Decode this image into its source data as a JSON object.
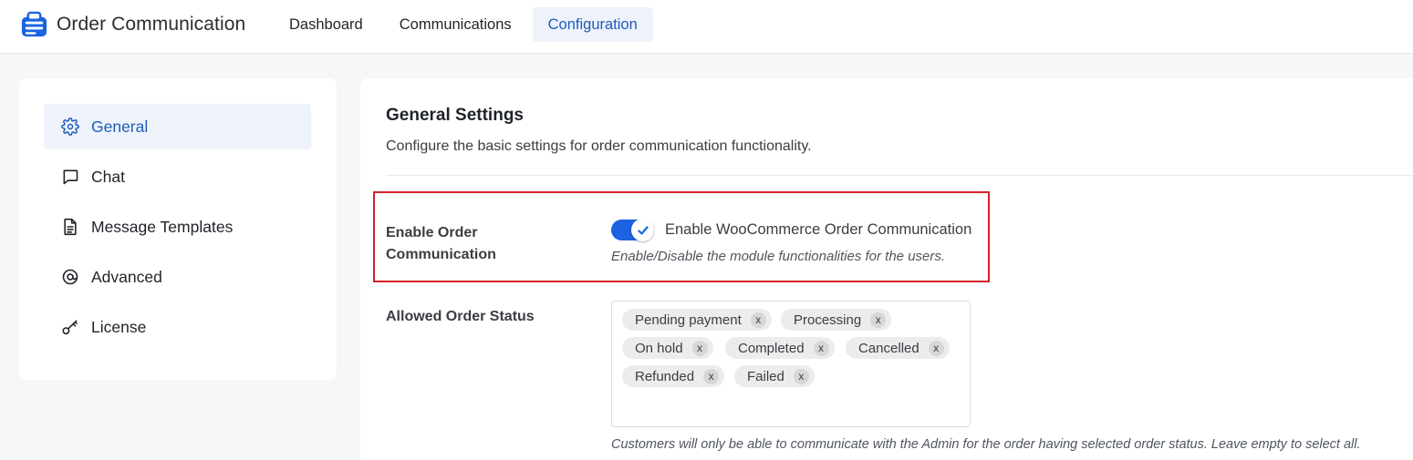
{
  "app": {
    "title": "Order Communication"
  },
  "nav": {
    "tabs": [
      {
        "label": "Dashboard"
      },
      {
        "label": "Communications"
      },
      {
        "label": "Configuration",
        "active": true
      }
    ]
  },
  "sidebar": {
    "items": [
      {
        "label": "General",
        "icon": "gear-icon",
        "active": true
      },
      {
        "label": "Chat",
        "icon": "chat-bubble-icon"
      },
      {
        "label": "Message Templates",
        "icon": "document-icon"
      },
      {
        "label": "Advanced",
        "icon": "at-sign-icon"
      },
      {
        "label": "License",
        "icon": "key-icon"
      }
    ]
  },
  "main": {
    "title": "General Settings",
    "description": "Configure the basic settings for order communication functionality.",
    "enable": {
      "label": "Enable Order Communication",
      "toggle_on": true,
      "toggle_label": "Enable WooCommerce Order Communication",
      "help": "Enable/Disable the module functionalities for the users."
    },
    "statuses": {
      "label": "Allowed Order Status",
      "tags": [
        {
          "label": "Pending payment",
          "remove": "x"
        },
        {
          "label": "Processing",
          "remove": "x"
        },
        {
          "label": "On hold",
          "remove": "x"
        },
        {
          "label": "Completed",
          "remove": "x"
        },
        {
          "label": "Cancelled",
          "remove": "x"
        },
        {
          "label": "Refunded",
          "remove": "x"
        },
        {
          "label": "Failed",
          "remove": "x"
        }
      ],
      "help": "Customers will only be able to communicate with the Admin for the order having selected order status. Leave empty to select all."
    }
  },
  "colors": {
    "accent": "#1b63e0",
    "active_bg": "#eef3fb",
    "active_text": "#1f5bb8",
    "highlight_border": "#d6202a"
  }
}
